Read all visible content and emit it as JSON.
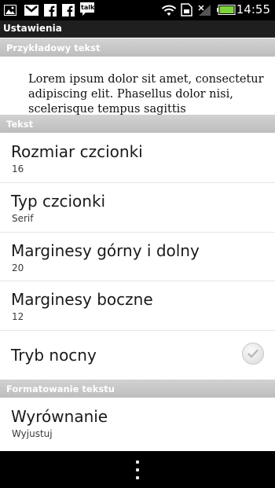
{
  "status_bar": {
    "time": "14:55",
    "icons": [
      "image-icon",
      "gmail-icon",
      "facebook-icon",
      "facebook-icon",
      "talk-icon",
      "wifi-icon",
      "sim-icon",
      "signal-icon",
      "battery-icon"
    ],
    "talk_text": "talk"
  },
  "app": {
    "title": "Ustawienia"
  },
  "preview": {
    "header": "Przykładowy tekst",
    "sample_text": "Lorem ipsum dolor sit amet, consectetur adipiscing elit. Phasellus dolor nisi, scelerisque tempus sagittis"
  },
  "sections": {
    "text": "Tekst",
    "formatting": "Formatowanie tekstu"
  },
  "settings": [
    {
      "title": "Rozmiar czcionki",
      "value": "16"
    },
    {
      "title": "Typ czcionki",
      "value": "Serif"
    },
    {
      "title": "Marginesy górny i dolny",
      "value": "20"
    },
    {
      "title": "Marginesy boczne",
      "value": "12"
    },
    {
      "title": "Tryb nocny",
      "checked": true
    },
    {
      "title": "Wyrównanie",
      "value": "Wyjustuj"
    }
  ],
  "colors": {
    "status_bar": "#000000",
    "title_bar": "#1f1f1f",
    "section_header": "#c8c8c8",
    "battery": "#7cd43a"
  }
}
